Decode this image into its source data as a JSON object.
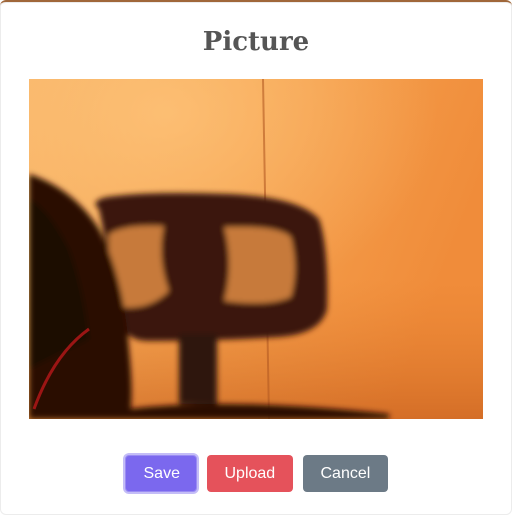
{
  "dialog": {
    "title": "Picture"
  },
  "preview": {
    "description_icon": "camera-preview",
    "colors": {
      "background": "#f4a35a",
      "shadow": "#2a0f05"
    }
  },
  "actions": {
    "save_label": "Save",
    "upload_label": "Upload",
    "cancel_label": "Cancel",
    "colors": {
      "save": "#7b68ee",
      "upload": "#e5525b",
      "cancel": "#6c7a86"
    }
  }
}
